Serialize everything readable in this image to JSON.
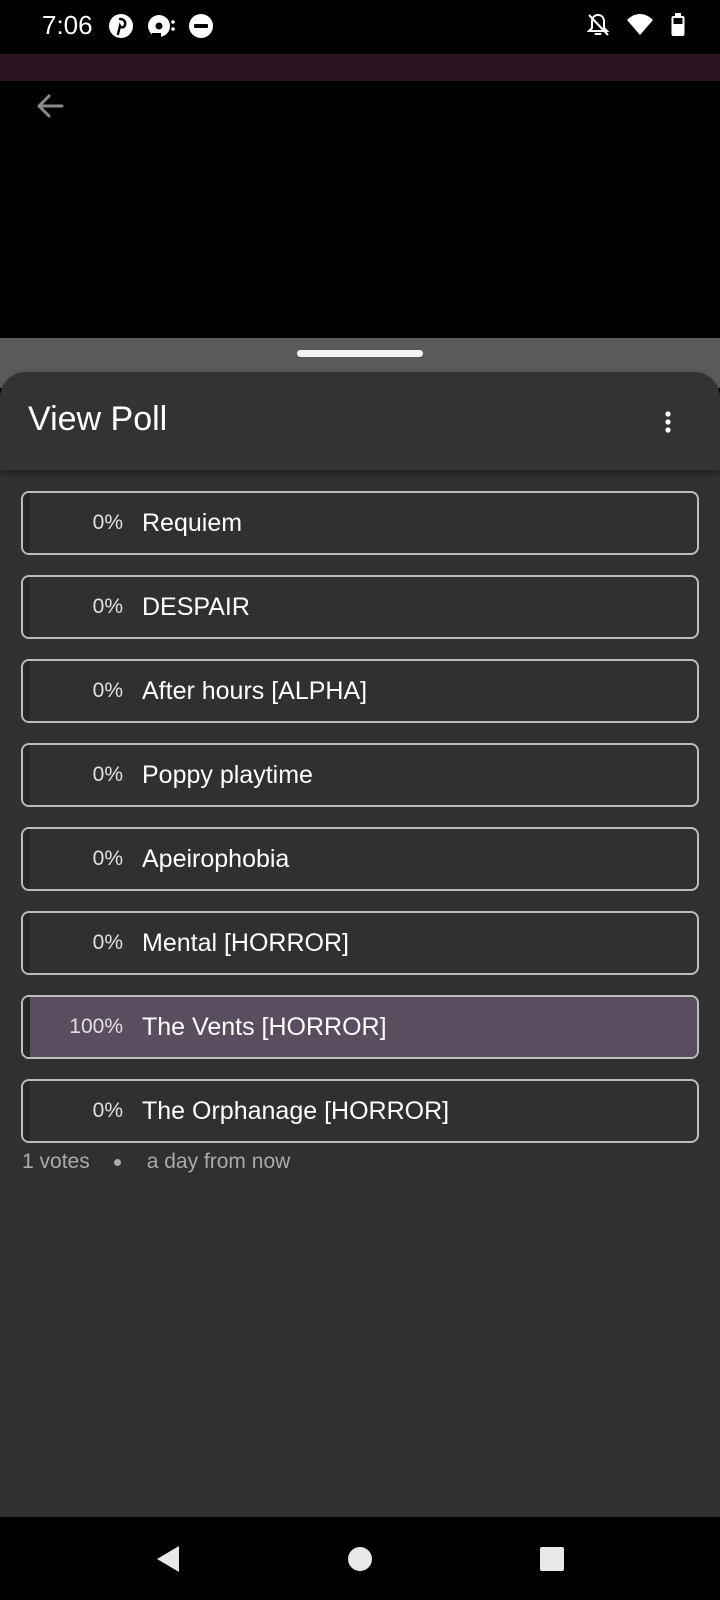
{
  "status_bar": {
    "time": "7:06",
    "left_icons": [
      "pinterest-icon",
      "podcast-icon",
      "do-not-disturb-icon"
    ],
    "right_icons": [
      "notifications-off-icon",
      "wifi-icon",
      "battery-icon"
    ]
  },
  "top": {
    "back_icon": "arrow-back-icon"
  },
  "sheet": {
    "title": "View Poll",
    "more_icon": "more-vertical-icon"
  },
  "poll": {
    "options": [
      {
        "percent_label": "0%",
        "percent": 0,
        "label": "Requiem"
      },
      {
        "percent_label": "0%",
        "percent": 0,
        "label": "DESPAIR"
      },
      {
        "percent_label": "0%",
        "percent": 0,
        "label": "After hours [ALPHA]"
      },
      {
        "percent_label": "0%",
        "percent": 0,
        "label": "Poppy playtime"
      },
      {
        "percent_label": "0%",
        "percent": 0,
        "label": "Apeirophobia"
      },
      {
        "percent_label": "0%",
        "percent": 0,
        "label": "Mental [HORROR]"
      },
      {
        "percent_label": "100%",
        "percent": 100,
        "label": "The Vents [HORROR]"
      },
      {
        "percent_label": "0%",
        "percent": 0,
        "label": "The Orphanage [HORROR]"
      }
    ],
    "votes": "1 votes",
    "expires": "a day from now"
  },
  "nav_bar": {
    "icons": [
      "back-triangle-icon",
      "home-circle-icon",
      "recents-square-icon"
    ]
  },
  "colors": {
    "sheet_bg": "#303030",
    "fill_color": "#5a4d60",
    "border": "#bdbdbd"
  }
}
